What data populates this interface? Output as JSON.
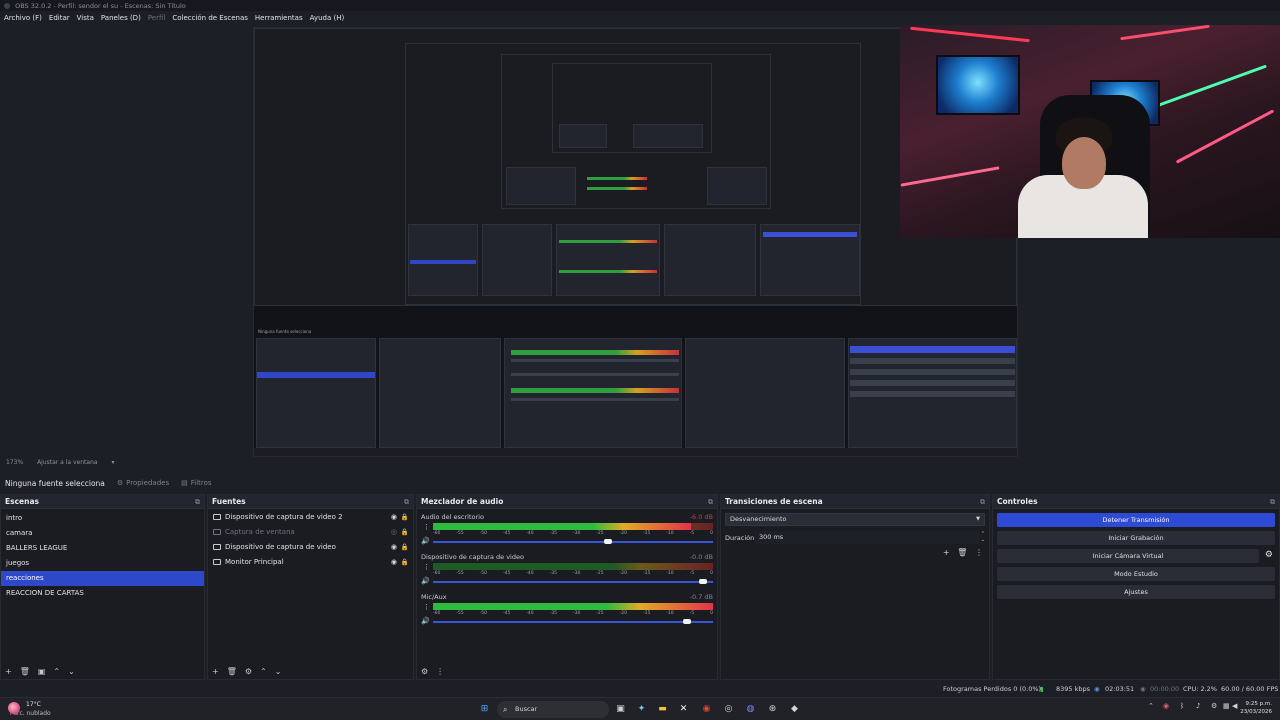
{
  "window": {
    "title": "OBS 32.0.2 - Perfil: sendor el su - Escenas: Sin Título"
  },
  "menu": [
    {
      "label": "Archivo (F)",
      "dim": false
    },
    {
      "label": "Editar",
      "dim": false
    },
    {
      "label": "Vista",
      "dim": false
    },
    {
      "label": "Paneles (D)",
      "dim": false
    },
    {
      "label": "Perfil",
      "dim": true
    },
    {
      "label": "Colección de Escenas",
      "dim": false
    },
    {
      "label": "Herramientas",
      "dim": false
    },
    {
      "label": "Ayuda (H)",
      "dim": false
    }
  ],
  "preview": {
    "zoom": "173%",
    "fit_label": "Ajustar a la ventana"
  },
  "source_toolbar": {
    "no_source": "Ninguna fuente selecciona",
    "properties": "Propiedades",
    "filters": "Filtros"
  },
  "scenes": {
    "title": "Escenas",
    "items": [
      "intro",
      "camara",
      "BALLERS LEAGUE",
      "juegos",
      "reacciones",
      "REACCION DE CARTAS"
    ],
    "selected_index": 4
  },
  "sources": {
    "title": "Fuentes",
    "items": [
      {
        "label": "Dispositivo de captura de video 2",
        "dim": false
      },
      {
        "label": "Captura de ventana",
        "dim": true
      },
      {
        "label": "Dispositivo de captura de video",
        "dim": false
      },
      {
        "label": "Monitor Principal",
        "dim": false
      }
    ]
  },
  "mixer": {
    "title": "Mezclador de audio",
    "ticks": [
      "-60",
      "-55",
      "-50",
      "-45",
      "-40",
      "-35",
      "-30",
      "-25",
      "-20",
      "-15",
      "-10",
      "-5",
      "0"
    ],
    "tracks": [
      {
        "name": "Audio del escritorio",
        "db": "-6.0 dB",
        "level": 0.92,
        "volume": 0.64,
        "red_db": true
      },
      {
        "name": "Dispositivo de captura de video",
        "db": "-0.0 dB",
        "level": 0.0,
        "volume": 0.98,
        "red_db": false
      },
      {
        "name": "Mic/Aux",
        "db": "-0.7 dB",
        "level": 1.0,
        "volume": 0.92,
        "red_db": false
      }
    ]
  },
  "transitions": {
    "title": "Transiciones de escena",
    "selected": "Desvanecimiento",
    "duration_label": "Duración",
    "duration_value": "300 ms"
  },
  "controls": {
    "title": "Controles",
    "buttons": [
      "Detener Transmisión",
      "Iniciar Grabación",
      "Iniciar Cámara Virtual",
      "Modo Estudio",
      "Ajustes"
    ]
  },
  "status": {
    "dropped": "Fotogramas Perdidos 0 (0.0%)",
    "bitrate": "8395 kbps",
    "stream_time": "02:03:51",
    "rec_time": "00:00:00",
    "cpu": "CPU: 2.2%",
    "fps": "60.00 / 60.00 FPS"
  },
  "taskbar": {
    "temp": "17°C",
    "weather": "Parc. nublado",
    "search": "Buscar",
    "time": "9:25 p.m.",
    "date": "23/03/2026"
  },
  "icons": {
    "gear": "gear-icon",
    "eye": "eye-icon",
    "lock": "lock-icon",
    "speaker": "speaker-icon",
    "windows": "windows-logo-icon"
  },
  "colors": {
    "accent": "#2f4ad4",
    "selection": "#2d48c9",
    "meter_green": "#2fbb3e",
    "meter_yellow": "#e2aa26",
    "meter_red": "#e2334a"
  }
}
